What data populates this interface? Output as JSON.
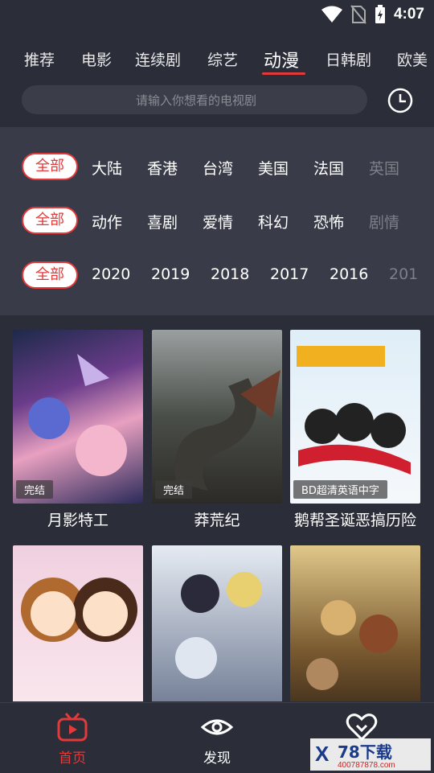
{
  "status": {
    "time": "4:07"
  },
  "tabs": [
    {
      "label": "推荐"
    },
    {
      "label": "电影"
    },
    {
      "label": "连续剧"
    },
    {
      "label": "综艺"
    },
    {
      "label": "动漫"
    },
    {
      "label": "日韩剧"
    },
    {
      "label": "欧美"
    }
  ],
  "search": {
    "placeholder": "请输入你想看的电视剧"
  },
  "filters": {
    "region": {
      "all": "全部",
      "items": [
        "大陆",
        "香港",
        "台湾",
        "美国",
        "法国",
        "英国"
      ]
    },
    "genre": {
      "all": "全部",
      "items": [
        "动作",
        "喜剧",
        "爱情",
        "科幻",
        "恐怖",
        "剧情"
      ]
    },
    "year": {
      "all": "全部",
      "items": [
        "2020",
        "2019",
        "2018",
        "2017",
        "2016",
        "201"
      ]
    }
  },
  "cards": [
    {
      "title": "月影特工",
      "badge": "完结"
    },
    {
      "title": "莽荒纪",
      "badge": "完结"
    },
    {
      "title": "鹅帮圣诞恶搞历险",
      "badge": "BD超清英语中字"
    },
    {
      "title": "",
      "badge": ""
    },
    {
      "title": "",
      "badge": ""
    },
    {
      "title": "",
      "badge": ""
    }
  ],
  "bottom_nav": [
    {
      "label": "首页"
    },
    {
      "label": "发现"
    },
    {
      "label": ""
    }
  ],
  "watermark": {
    "brand": "78下载",
    "url": "400787878.com"
  },
  "colors": {
    "accent": "#e23a3a",
    "bg": "#2b2e38",
    "panel": "#393c48"
  }
}
